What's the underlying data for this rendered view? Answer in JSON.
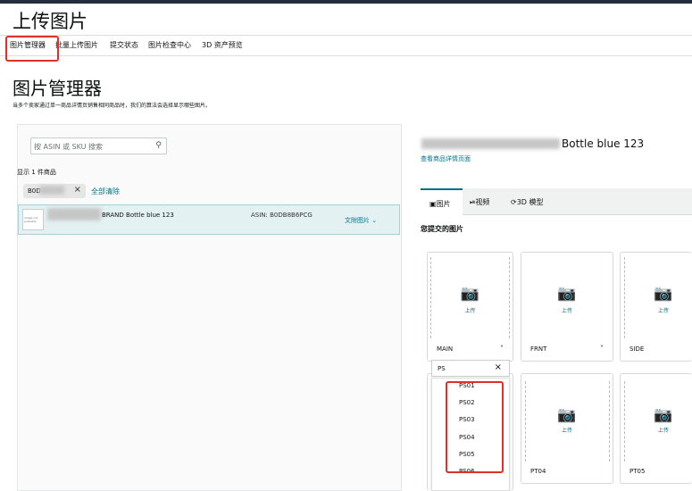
{
  "header": {
    "title": "上传图片"
  },
  "nav": {
    "tabs": [
      {
        "label": "图片管理器"
      },
      {
        "label": "批量上传图片"
      },
      {
        "label": "提交状态"
      },
      {
        "label": "图片检查中心"
      },
      {
        "label": "3D 资产预览"
      }
    ]
  },
  "manager": {
    "title": "图片管理器",
    "subtitle": "当多个卖家通过单一商品详情页销售相同商品时，我们的算法会选择显示哪些图片。"
  },
  "left": {
    "search_placeholder": "按 ASIN 或 SKU 搜索",
    "count_text": "显示 1 件商品",
    "chip_text": "B0D",
    "clear_all": "全部清除",
    "row": {
      "title": "BRAND Bottle blue 123",
      "asin": "ASIN: B0DB8B6PCG",
      "attach": "文附图片",
      "thumb_text": "image not available"
    }
  },
  "right": {
    "product_title": "Bottle blue 123",
    "detail_link": "查看商品详情页面",
    "media_tabs": [
      {
        "label": "图片",
        "icon": "image-icon"
      },
      {
        "label": "视频",
        "icon": "play-icon"
      },
      {
        "label": "3D 模型",
        "icon": "cube-icon"
      }
    ],
    "section_label": "您提交的图片",
    "upload_label": "上传",
    "cards_top": [
      {
        "label": "MAIN"
      },
      {
        "label": "FRNT"
      },
      {
        "label": "SIDE"
      }
    ],
    "cards_bottom": [
      {
        "label": "PT04"
      },
      {
        "label": "PT05"
      }
    ],
    "dropdown": {
      "value": "PS",
      "options": [
        "PS01",
        "PS02",
        "PS03",
        "PS04",
        "PS05",
        "PS06"
      ]
    }
  },
  "colors": {
    "highlight": "#e0302a",
    "link": "#007185",
    "selected_row": "#e3f1f3"
  }
}
